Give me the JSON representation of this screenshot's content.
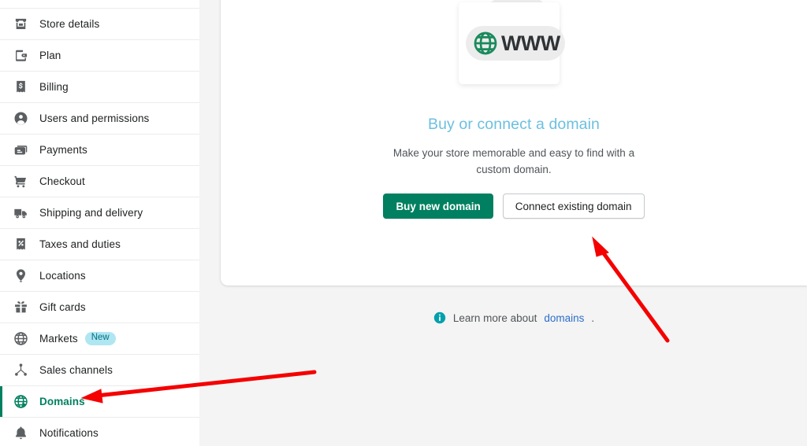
{
  "sidebar": {
    "items": [
      {
        "label": "Store details",
        "icon": "storefront-icon",
        "active": false,
        "badge": null
      },
      {
        "label": "Plan",
        "icon": "wallet-icon",
        "active": false,
        "badge": null
      },
      {
        "label": "Billing",
        "icon": "receipt-dollar-icon",
        "active": false,
        "badge": null
      },
      {
        "label": "Users and permissions",
        "icon": "user-circle-icon",
        "active": false,
        "badge": null
      },
      {
        "label": "Payments",
        "icon": "payment-card-icon",
        "active": false,
        "badge": null
      },
      {
        "label": "Checkout",
        "icon": "shopping-cart-icon",
        "active": false,
        "badge": null
      },
      {
        "label": "Shipping and delivery",
        "icon": "delivery-truck-icon",
        "active": false,
        "badge": null
      },
      {
        "label": "Taxes and duties",
        "icon": "percent-receipt-icon",
        "active": false,
        "badge": null
      },
      {
        "label": "Locations",
        "icon": "map-pin-icon",
        "active": false,
        "badge": null
      },
      {
        "label": "Gift cards",
        "icon": "gift-icon",
        "active": false,
        "badge": null
      },
      {
        "label": "Markets",
        "icon": "globe-icon",
        "active": false,
        "badge": "New"
      },
      {
        "label": "Sales channels",
        "icon": "channels-node-icon",
        "active": false,
        "badge": null
      },
      {
        "label": "Domains",
        "icon": "globe-pointer-icon",
        "active": true,
        "badge": null
      },
      {
        "label": "Notifications",
        "icon": "bell-icon",
        "active": false,
        "badge": null
      }
    ]
  },
  "main": {
    "illustration": {
      "icon": "globe-icon",
      "www_text": "WWW"
    },
    "headline": "Buy or connect a domain",
    "subtext": "Make your store memorable and easy to find with a custom domain.",
    "primary_button": "Buy new domain",
    "secondary_button": "Connect existing domain"
  },
  "footnote": {
    "icon": "info-circle-icon",
    "text_before": "Learn more about ",
    "link_text": "domains",
    "text_after": "."
  },
  "colors": {
    "brand_green": "#008060",
    "headline_blue": "#6cc0e0",
    "link_blue": "#2c6ecb",
    "badge_bg": "#afe6f2",
    "badge_text": "#00707f",
    "info_teal": "#00a0ac",
    "annotation_red": "#f50000",
    "page_bg": "#f4f4f4"
  }
}
